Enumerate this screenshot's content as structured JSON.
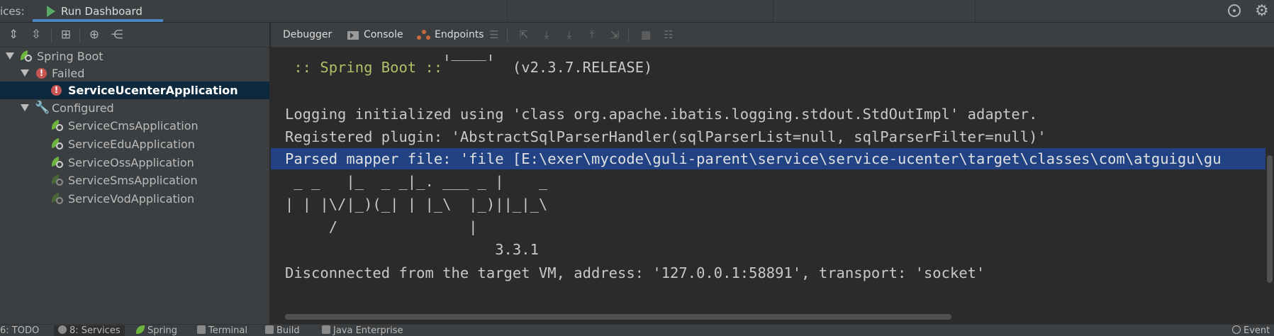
{
  "topbar": {
    "services_label": "ices:",
    "run_dashboard_tab": "Run Dashboard"
  },
  "tree": {
    "root": "Spring Boot",
    "failed_group": "Failed",
    "failed_items": [
      "ServiceUcenterApplication"
    ],
    "configured_group": "Configured",
    "configured_items": [
      "ServiceCmsApplication",
      "ServiceEduApplication",
      "ServiceOssApplication",
      "ServiceSmsApplication",
      "ServiceVodApplication"
    ]
  },
  "console_toolbar": {
    "debugger_tab": "Debugger",
    "console_tab": "Console",
    "endpoints_tab": "Endpoints"
  },
  "console": {
    "lines": [
      "                  |____|",
      " :: Spring Boot ::        (v2.3.7.RELEASE)",
      "",
      "Logging initialized using 'class org.apache.ibatis.logging.stdout.StdOutImpl' adapter.",
      "Registered plugin: 'AbstractSqlParserHandler(sqlParserList=null, sqlParserFilter=null)'",
      "Parsed mapper file: 'file [E:\\exer\\mycode\\guli-parent\\service\\service-ucenter\\target\\classes\\com\\atguigu\\gu",
      " _ _   |_  _ _|_. ___ _ |    _",
      "| | |\\/|_)(_| | |_\\  |_)||_|_\\",
      "     /               |",
      "                        3.3.1",
      "Disconnected from the target VM, address: '127.0.0.1:58891', transport: 'socket'"
    ]
  },
  "statusbar": {
    "todo": "6: TODO",
    "services": "8: Services",
    "spring": "Spring",
    "terminal": "Terminal",
    "build": "Build",
    "java_enterprise": "Java Enterprise",
    "event": "Event"
  },
  "colors": {
    "accent": "#4a88c7",
    "selection": "#0d293e",
    "highlight": "#214283",
    "spring_green": "#6db33f",
    "spring_boot_banner": "#b5bd68",
    "error": "#c75450"
  }
}
